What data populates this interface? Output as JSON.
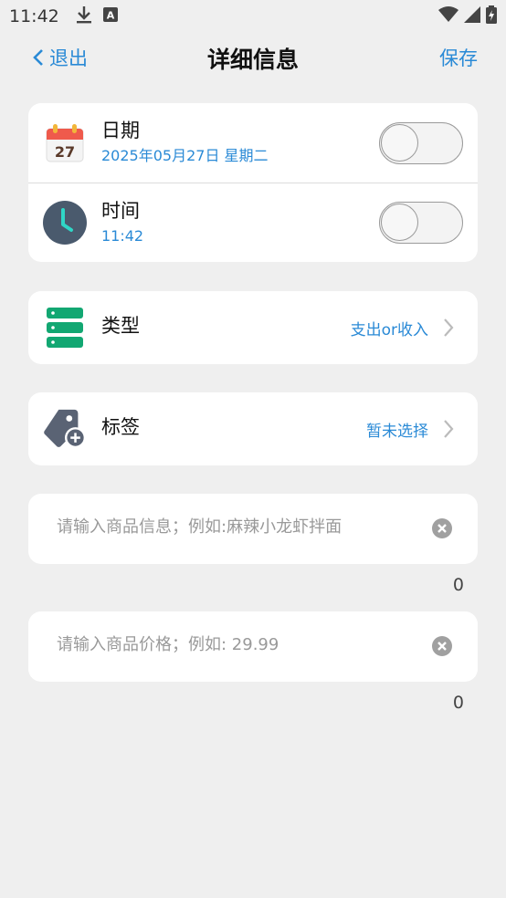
{
  "status_bar": {
    "time": "11:42",
    "icons": [
      "download-icon",
      "a-notification-icon",
      "wifi-icon",
      "signal-icon",
      "battery-charging-icon"
    ]
  },
  "nav": {
    "back_label": "退出",
    "title": "详细信息",
    "save_label": "保存"
  },
  "date_time_card": {
    "date": {
      "label": "日期",
      "value": "2025年05月27日 星期二",
      "calendar_day": "27",
      "toggle_on": false
    },
    "time": {
      "label": "时间",
      "value": "11:42",
      "toggle_on": false
    }
  },
  "type_row": {
    "label": "类型",
    "value": "支出or收入"
  },
  "tag_row": {
    "label": "标签",
    "value": "暂未选择"
  },
  "product_info": {
    "placeholder": "请输入商品信息；例如:麻辣小龙虾拌面",
    "value": "",
    "count": "0"
  },
  "product_price": {
    "placeholder": "请输入商品价格；例如: 29.99",
    "value": "",
    "count": "0"
  },
  "colors": {
    "accent": "#2a8ad6",
    "background": "#efefef",
    "type_icon": "#12a772",
    "clock_icon": "#4a5a6d",
    "tag_icon": "#5a6374"
  }
}
